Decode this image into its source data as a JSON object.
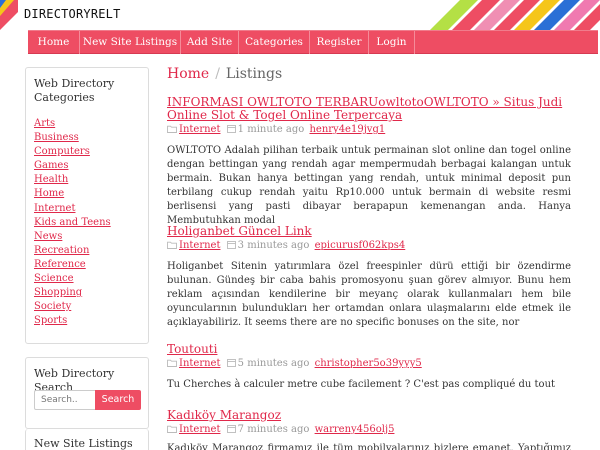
{
  "site": {
    "logo": "DIRECTORYRELT"
  },
  "nav": [
    {
      "label": "Home"
    },
    {
      "label": "New Site Listings"
    },
    {
      "label": "Add Site"
    },
    {
      "label": "Categories"
    },
    {
      "label": "Register"
    },
    {
      "label": "Login"
    }
  ],
  "sidebar": {
    "categories_title": "Web Directory Categories",
    "categories": [
      "Arts",
      "Business",
      "Computers",
      "Games",
      "Health",
      "Home",
      "Internet",
      "Kids and Teens",
      "News",
      "Recreation",
      "Reference",
      "Science",
      "Shopping",
      "Society",
      "Sports"
    ],
    "search_title": "Web Directory Search",
    "search_placeholder": "Search..",
    "search_button": "Search",
    "new_listings_title": "New Site Listings"
  },
  "breadcrumb": {
    "home": "Home",
    "separator": "/",
    "current": "Listings"
  },
  "listings": [
    {
      "title": "INFORMASI OWLTOTO TERBARUowltotoOWLTOTO » Situs Judi Online Slot & Togel Online Terpercaya",
      "category": "Internet",
      "time": "1 minute ago",
      "user": "henry4e19jvg1",
      "description": "OWLTOTO Adalah pilihan terbaik untuk permainan slot online dan togel online dengan bettingan yang rendah agar mempermudah berbagai kalangan untuk bermain. Bukan hanya bettingan yang rendah, untuk minimal deposit pun terbilang cukup rendah yaitu Rp10.000 untuk bermain di website resmi berlisensi yang pasti dibayar berapapun kemenangan anda. Hanya Membutuhkan modal"
    },
    {
      "title": "Holiganbet Güncel Link",
      "category": "Internet",
      "time": "3 minutes ago",
      "user": "epicurusf062kps4",
      "description": "Holiganbet Sitenin yatırımlara özel freespinler dürü ettiği bir özendirme bulunan. Gündeş bir caba bahis promosyonu şuan görev almıyor. Bunu hem reklam açısından kendilerine bir meyanç olarak kullanmaları hem bile oyuncularının bulundukları her ortamdan onlara ulaşmalarını elde etmek ile açıklayabiliriz. It seems there are no specific bonuses on the site, nor"
    },
    {
      "title": "Toutouti",
      "category": "Internet",
      "time": "5 minutes ago",
      "user": "christopher5o39yyy5",
      "description": "Tu Cherches à calculer metre cube facilement ? C'est pas compliqué du tout"
    },
    {
      "title": "Kadıköy Marangoz",
      "category": "Internet",
      "time": "7 minutes ago",
      "user": "warreny456olj5",
      "description": "Kadıköy Marangoz firmamız ile tüm mobilyalarınız bizlere emanet. Yaptığımız bu"
    }
  ],
  "colors": {
    "accent": "#ee4d63",
    "link": "#e0284a"
  }
}
